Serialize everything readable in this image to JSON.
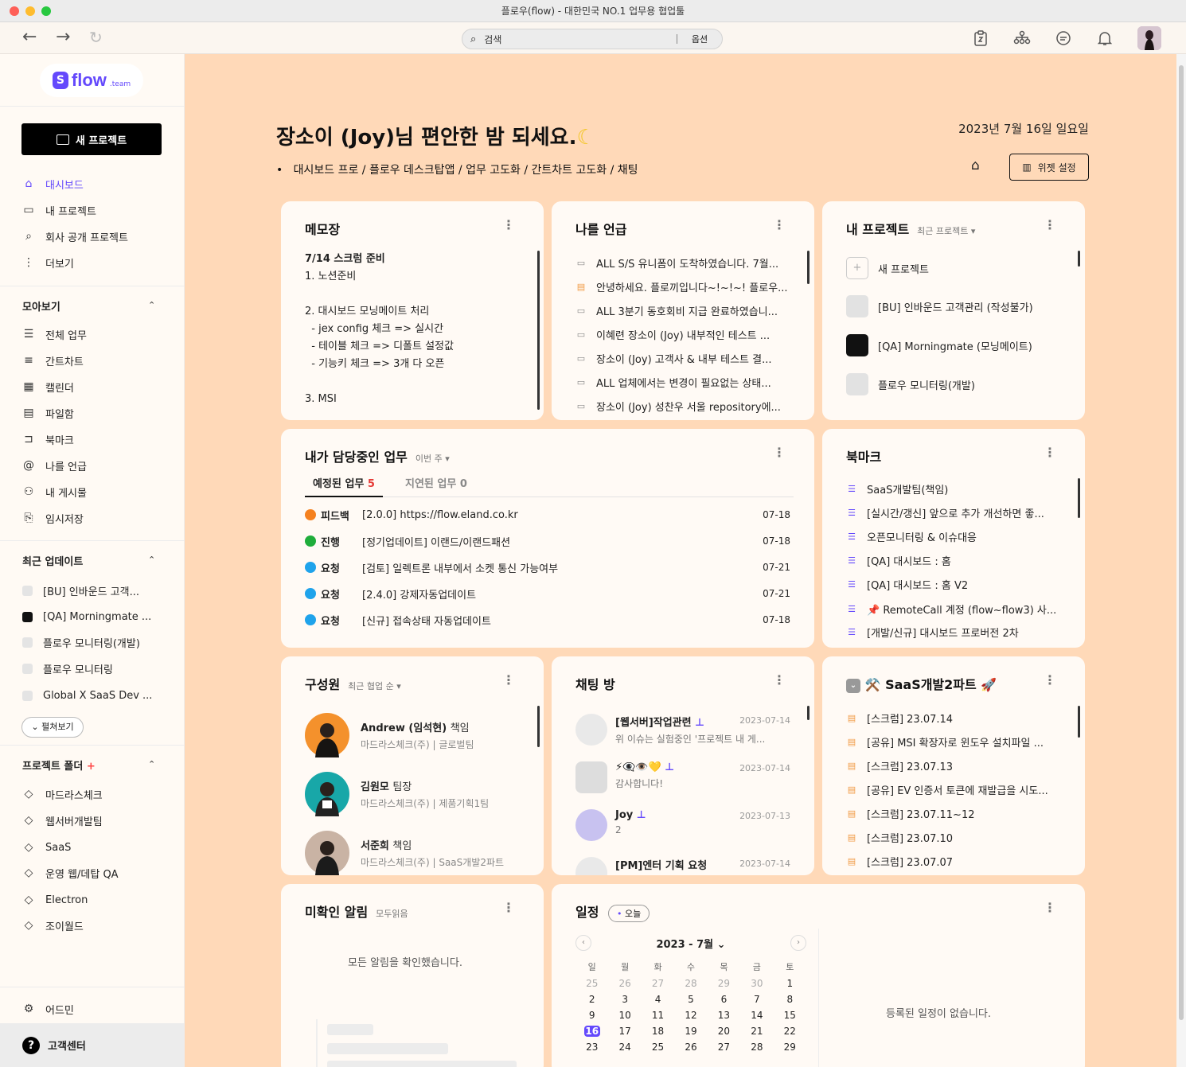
{
  "window": {
    "title": "플로우(flow) - 대한민국 NO.1 업무용 협업툴"
  },
  "search": {
    "placeholder": "검색",
    "options": "옵션"
  },
  "brand": {
    "word": "flow",
    "suffix": ".team",
    "accent": "#6449fc"
  },
  "sidebar": {
    "new_project": "새 프로젝트",
    "nav": [
      {
        "label": "대시보드"
      },
      {
        "label": "내 프로젝트"
      },
      {
        "label": "회사 공개 프로젝트"
      },
      {
        "label": "더보기"
      }
    ],
    "collect_title": "모아보기",
    "collect": [
      {
        "label": "전체 업무"
      },
      {
        "label": "간트차트"
      },
      {
        "label": "캘린더"
      },
      {
        "label": "파일함"
      },
      {
        "label": "북마크"
      },
      {
        "label": "나를 언급"
      },
      {
        "label": "내 게시물"
      },
      {
        "label": "임시저장"
      }
    ],
    "recent_title": "최근 업데이트",
    "recent": [
      {
        "label": "[BU] 인바운드 고객...",
        "color": "#e4e4e4"
      },
      {
        "label": "[QA] Morningmate ...",
        "color": "#111111"
      },
      {
        "label": "플로우 모니터링(개발)",
        "color": "#e4e4e4"
      },
      {
        "label": "플로우 모니터링",
        "color": "#e4e4e4"
      },
      {
        "label": "Global X SaaS Dev ...",
        "color": "#e4e4e4"
      }
    ],
    "expand": "펼쳐보기",
    "folder_title": "프로젝트 폴더",
    "folders": [
      {
        "label": "마드라스체크"
      },
      {
        "label": "웹서버개발팀"
      },
      {
        "label": "SaaS"
      },
      {
        "label": "운영 웹/데탑 QA"
      },
      {
        "label": "Electron"
      },
      {
        "label": "조이월드"
      }
    ],
    "admin": "어드민",
    "help": "고객센터"
  },
  "header": {
    "greeting": "장소이 (Joy)님 편안한 밤 되세요.",
    "date": "2023년 7월 16일 일요일",
    "breadcrumb": "대시보드 프로 / 플로우 데스크탑앱 / 업무 고도화 / 간트차트 고도화 / 채팅",
    "widget_settings": "위젯 설정"
  },
  "memo": {
    "title": "메모장",
    "heading": "7/14 스크럼 준비",
    "body": "\n1. 노션준비\n\n2. 대시보드 모닝메이트 처리\n  - jex config 체크 => 실시간\n  - 테이블 체크 => 디폴트 설정값\n  - 기능키 체크 => 3개 다 오픈\n\n3. MSI"
  },
  "mentions": {
    "title": "나를 언급",
    "items": [
      {
        "text": "ALL S/S 유니폼이 도착하였습니다. 7월...",
        "icon": "comment"
      },
      {
        "text": "안녕하세요. 플로끼입니다~!~!~! 플로우...",
        "icon": "post"
      },
      {
        "text": "ALL 3분기 동호회비 지급 완료하였습니...",
        "icon": "comment"
      },
      {
        "text": "이혜련 장소이 (Joy)  내부적인 테스트 ...",
        "icon": "comment"
      },
      {
        "text": "장소이 (Joy)  고객사 & 내부 테스트 결...",
        "icon": "comment"
      },
      {
        "text": "ALL  업체에서는 변경이 필요없는 상태...",
        "icon": "comment"
      },
      {
        "text": "장소이 (Joy) 성찬우  서울 repository에...",
        "icon": "comment"
      }
    ]
  },
  "projects": {
    "title": "내 프로젝트",
    "sub": "최근 프로젝트",
    "new": "새 프로젝트",
    "items": [
      {
        "label": "[BU] 인바운드 고객관리 (작성불가)",
        "color": "#e2e2e2"
      },
      {
        "label": "[QA] Morningmate (모닝메이트)",
        "color": "#111111"
      },
      {
        "label": "플로우 모니터링(개발)",
        "color": "#e2e2e2"
      }
    ]
  },
  "tasks": {
    "title": "내가 담당중인 업무",
    "sub": "이번 주",
    "tab_scheduled": "예정된 업무",
    "scheduled_count": "5",
    "tab_delayed": "지연된 업무",
    "delayed_count": "0",
    "rows": [
      {
        "status": "피드백",
        "color": "#f5811f",
        "text": "[2.0.0] https://flow.eland.co.kr",
        "date": "07-18"
      },
      {
        "status": "진행",
        "color": "#1fad3b",
        "text": "[정기업데이트] 이랜드/이랜드패션",
        "date": "07-18"
      },
      {
        "status": "요청",
        "color": "#1fa3eb",
        "text": "[검토] 일렉트론 내부에서 소켓 통신 가능여부",
        "date": "07-21"
      },
      {
        "status": "요청",
        "color": "#1fa3eb",
        "text": "[2.4.0] 강제자동업데이트",
        "date": "07-21"
      },
      {
        "status": "요청",
        "color": "#1fa3eb",
        "text": "[신규] 접속상태 자동업데이트",
        "date": "07-18"
      }
    ]
  },
  "bookmarks": {
    "title": "북마크",
    "items": [
      {
        "text": "SaaS개발팀(책임)"
      },
      {
        "text": "[실시간/갱신] 앞으로 추가 개선하면 좋..."
      },
      {
        "text": "오픈모니터링 & 이슈대응"
      },
      {
        "text": "[QA] 대시보드 : 홈"
      },
      {
        "text": "[QA] 대시보드 : 홈 V2"
      },
      {
        "text": "📌 RemoteCall 계정 (flow~flow3) 사..."
      },
      {
        "text": "[개발/신규] 대시보드 프로버전 2차"
      }
    ]
  },
  "members": {
    "title": "구성원",
    "sub": "최근 협업 순",
    "items": [
      {
        "name": "Andrew (임석현)",
        "role": "책임",
        "org": "마드라스체크(주)",
        "team": "글로벌팀",
        "color": "#f4912c"
      },
      {
        "name": "김원모",
        "role": "팀장",
        "org": "마드라스체크(주)",
        "team": "제품기획1팀",
        "color": "#18a7a8"
      },
      {
        "name": "서준희",
        "role": "책임",
        "org": "마드라스체크(주)",
        "team": "SaaS개발2파트",
        "color": "#c9b3a4"
      }
    ]
  },
  "chats": {
    "title": "채팅 방",
    "items": [
      {
        "name": "[웹서버]작업관련",
        "msg": "위 이슈는 실험중인 '프로젝트 내 게...",
        "time": "2023-07-14"
      },
      {
        "name": "⚡👁️‍🗨️👁️💛",
        "msg": "감사합니다!",
        "time": "2023-07-14"
      },
      {
        "name": "Joy",
        "msg": "2",
        "time": "2023-07-13"
      },
      {
        "name": "[PM]엔터 기획 요청",
        "msg": "",
        "time": "2023-07-14"
      }
    ]
  },
  "saas": {
    "title": "⚒️ SaaS개발2파트 🚀",
    "items": [
      {
        "text": "[스크럼] 23.07.14"
      },
      {
        "text": "[공유] MSI 확장자로 윈도우 설치파일 ..."
      },
      {
        "text": "[스크럼] 23.07.13"
      },
      {
        "text": "[공유] EV 인증서 토큰에 재발급을 시도..."
      },
      {
        "text": "[스크럼] 23.07.11~12"
      },
      {
        "text": "[스크럼] 23.07.10"
      },
      {
        "text": "[스크럼] 23.07.07"
      }
    ]
  },
  "alerts": {
    "title": "미확인 알림",
    "sub": "모두읽음",
    "empty": "모든 알림을 확인했습니다."
  },
  "schedule": {
    "title": "일정",
    "today": "오늘",
    "month": "2023 - 7월",
    "weekdays": [
      "일",
      "월",
      "화",
      "수",
      "목",
      "금",
      "토"
    ],
    "days": [
      "25",
      "26",
      "27",
      "28",
      "29",
      "30",
      "1",
      "2",
      "3",
      "4",
      "5",
      "6",
      "7",
      "8",
      "9",
      "10",
      "11",
      "12",
      "13",
      "14",
      "15",
      "16",
      "17",
      "18",
      "19",
      "20",
      "21",
      "22",
      "23",
      "24",
      "25",
      "26",
      "27",
      "28",
      "29"
    ],
    "today_day": "16",
    "empty": "등록된 일정이 없습니다."
  }
}
